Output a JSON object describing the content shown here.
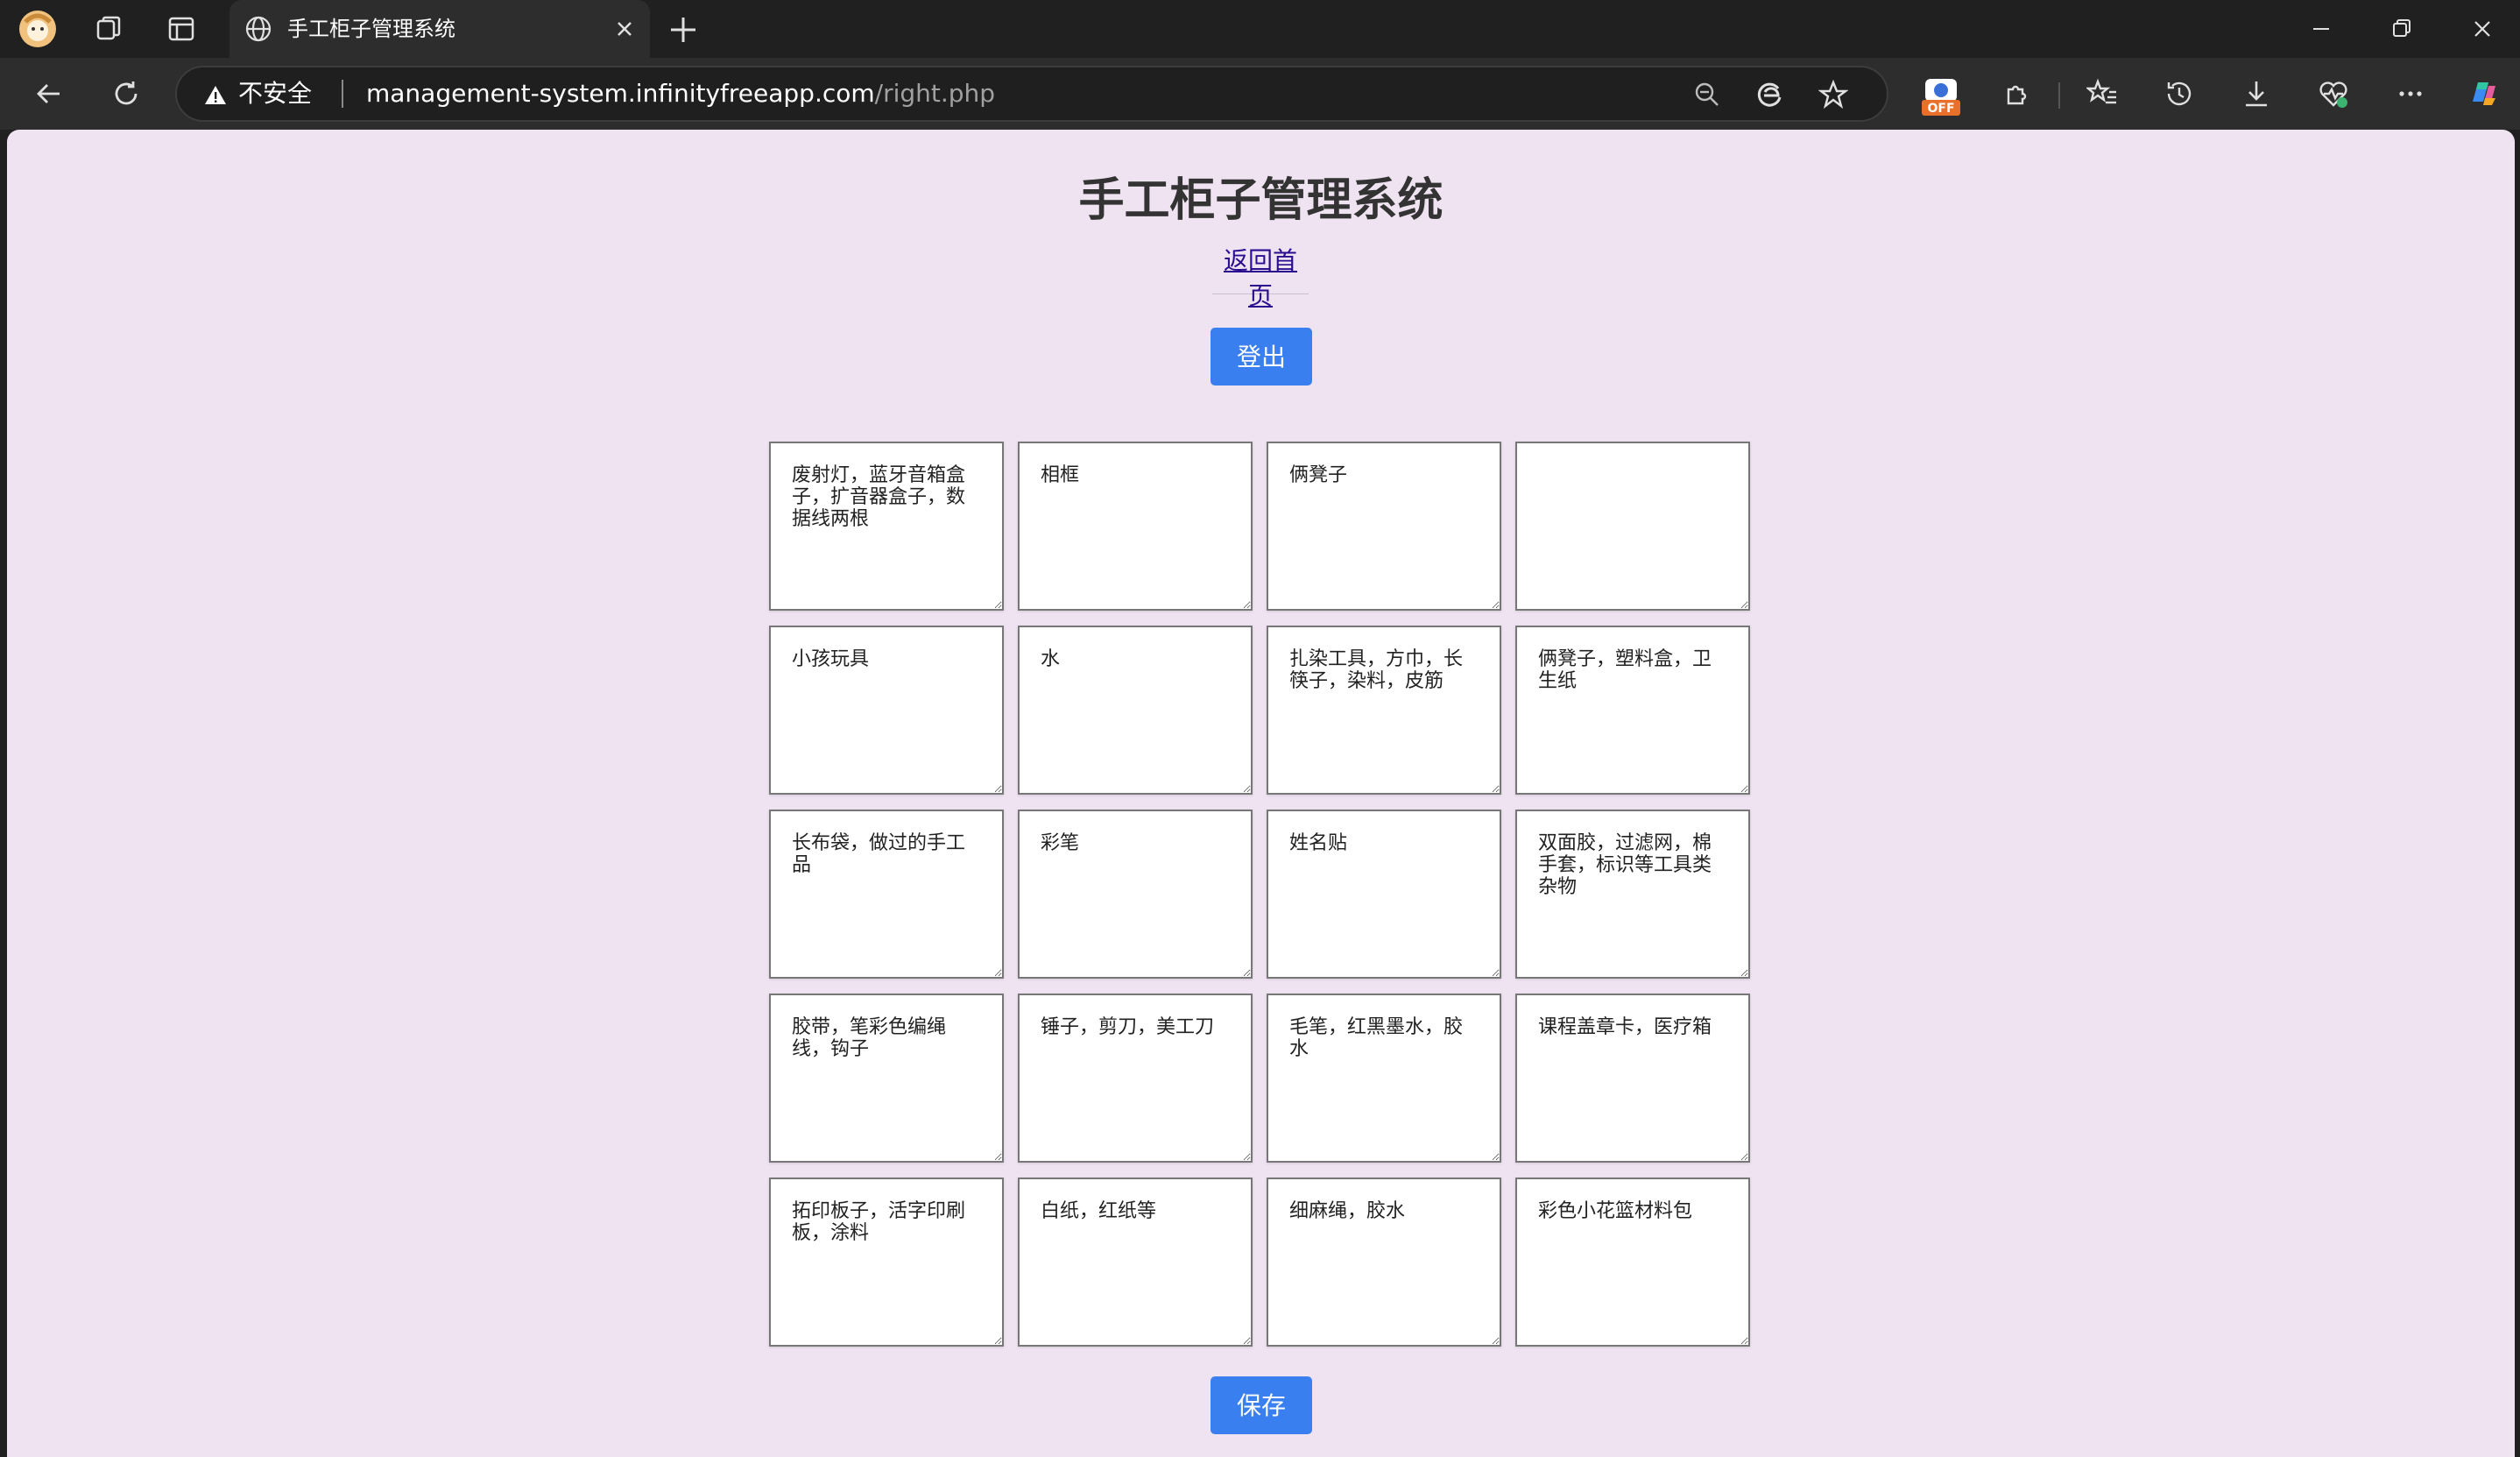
{
  "browser": {
    "tab": {
      "title": "手工柜子管理系统"
    },
    "address_bar": {
      "security_label": "不安全",
      "url_host": "management-system.infinityfreeapp.com",
      "url_path": "/right.php"
    },
    "extension_badge": "OFF"
  },
  "page": {
    "title": "手工柜子管理系统",
    "home_link": "返回首页",
    "logout_button": "登出",
    "save_button": "保存",
    "cells": [
      "废射灯，蓝牙音箱盒子，扩音器盒子，数据线两根",
      "相框",
      "俩凳子",
      "",
      "小孩玩具",
      "水",
      "扎染工具，方巾，长筷子，染料，皮筋",
      "俩凳子，塑料盒，卫生纸",
      "长布袋，做过的手工品",
      "彩笔",
      "姓名贴",
      "双面胶，过滤网，棉手套，标识等工具类杂物",
      "胶带，笔彩色编绳线，钩子",
      "锤子，剪刀，美工刀",
      "毛笔，红黑墨水，胶水",
      "课程盖章卡，医疗箱",
      "拓印板子，活字印刷板，涂料",
      "白纸，红纸等",
      "细麻绳，胶水",
      "彩色小花篮材料包"
    ]
  },
  "colors": {
    "page_background": "#efe3f2",
    "button": "#3a7ff0",
    "link": "#2a0d8f"
  }
}
